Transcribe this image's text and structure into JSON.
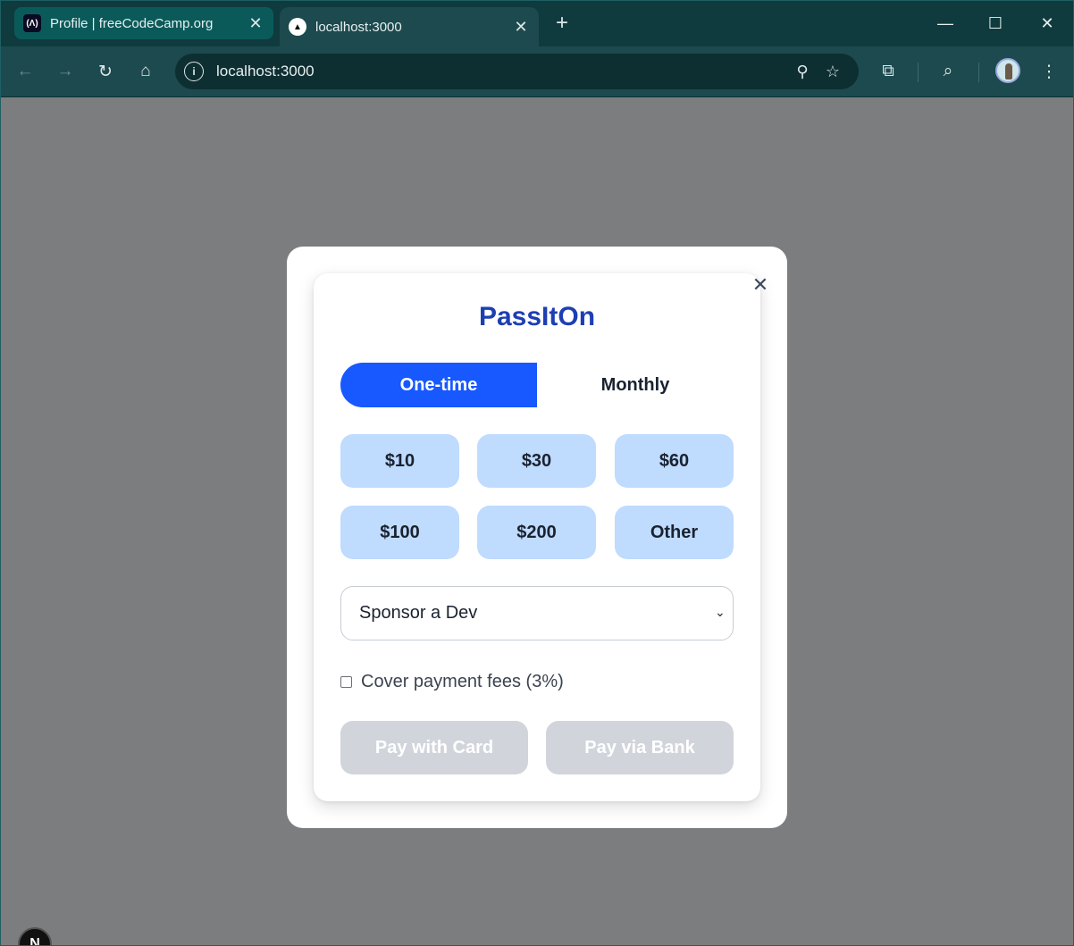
{
  "browser": {
    "tabs": [
      {
        "title": "Profile | freeCodeCamp.org",
        "favicon": "freecodecamp-icon",
        "active": false
      },
      {
        "title": "localhost:3000",
        "favicon": "vercel-triangle-icon",
        "active": true
      }
    ],
    "new_tab_glyph": "+",
    "url": "localhost:3000",
    "colors": {
      "frame": "#0f3b3e",
      "toolbar": "#1c4a4e",
      "omnibox": "#0d2f32"
    }
  },
  "page": {
    "overlay_color": "#7c7d7f"
  },
  "modal": {
    "title": "PassItOn",
    "close_glyph": "✕",
    "frequency_tabs": [
      {
        "label": "One-time",
        "selected": true
      },
      {
        "label": "Monthly",
        "selected": false
      }
    ],
    "amounts": [
      "$10",
      "$30",
      "$60",
      "$100",
      "$200",
      "Other"
    ],
    "purpose_select": {
      "value": "Sponsor a Dev"
    },
    "cover_fees": {
      "label": "Cover payment fees (3%)",
      "checked": false
    },
    "pay_buttons": [
      {
        "label": "Pay with Card",
        "disabled": true
      },
      {
        "label": "Pay via Bank",
        "disabled": true
      }
    ],
    "colors": {
      "primary": "#1758ff",
      "brand": "#1d3fb3",
      "amount_bg": "#bfdbfe",
      "disabled_bg": "#d1d5db"
    }
  },
  "dev_badge": {
    "label": "N"
  }
}
